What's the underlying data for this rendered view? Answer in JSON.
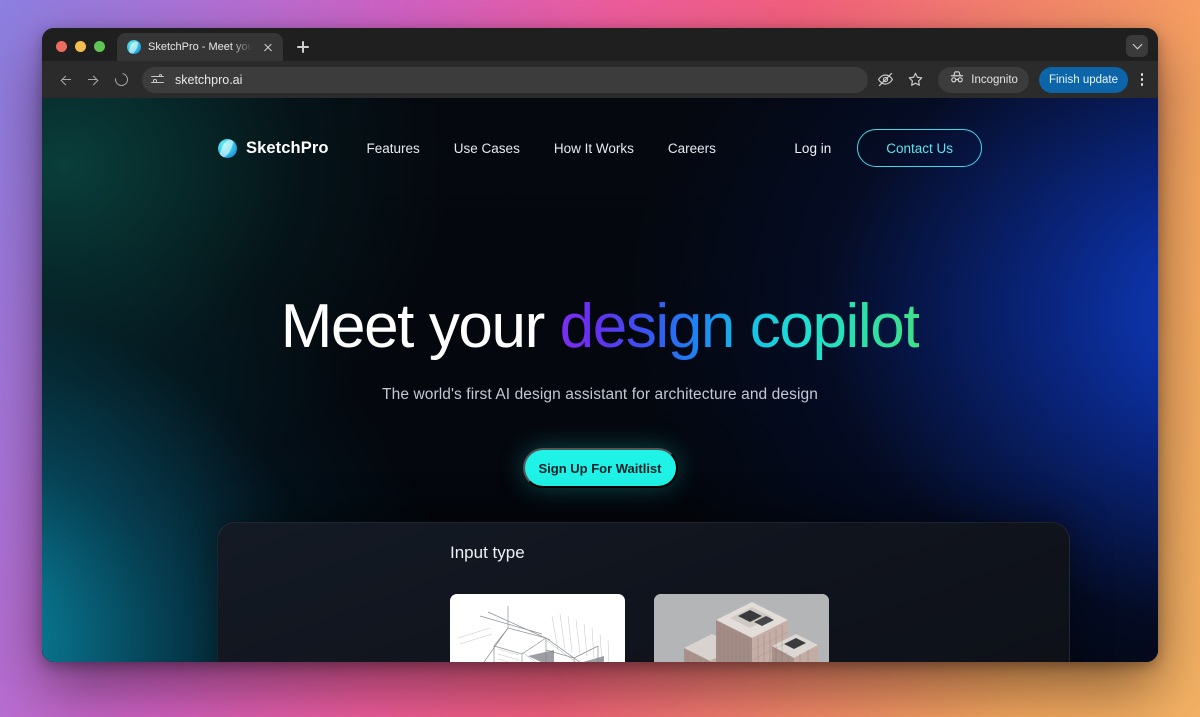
{
  "browser": {
    "tab": {
      "title": "SketchPro - Meet your design",
      "favicon_icon": "sketchpro-logo-icon",
      "close_icon": "close-icon"
    },
    "new_tab_icon": "plus-icon",
    "tab_list_icon": "chevron-down-icon",
    "nav": {
      "back_icon": "back-arrow-icon",
      "forward_icon": "forward-arrow-icon",
      "reload_icon": "reload-icon"
    },
    "omnibox": {
      "site_settings_icon": "tune-sliders-icon",
      "url": "sketchpro.ai"
    },
    "actions": {
      "tracking_protection_icon": "eye-slash-icon",
      "bookmark_icon": "star-icon",
      "incognito_icon": "incognito-hat-icon",
      "incognito_label": "Incognito",
      "update_label": "Finish update",
      "menu_icon": "kebab-menu-icon"
    },
    "window_controls": {
      "close": "close-traffic-light",
      "minimize": "minimize-traffic-light",
      "maximize": "maximize-traffic-light"
    }
  },
  "site": {
    "brand": {
      "name": "SketchPro",
      "logo_icon": "sketchpro-logo-icon"
    },
    "nav_links": [
      {
        "label": "Features"
      },
      {
        "label": "Use Cases"
      },
      {
        "label": "How It Works"
      },
      {
        "label": "Careers"
      }
    ],
    "login_label": "Log in",
    "contact_label": "Contact Us",
    "hero": {
      "headline_plain": "Meet your ",
      "headline_gradient": "design copilot",
      "subtitle": "The world's first AI design assistant for architecture and design",
      "cta_label": "Sign Up For Waitlist"
    },
    "panel": {
      "title": "Input type",
      "options": [
        {
          "name": "sketch-thumbnail",
          "alt": "architectural line sketch"
        },
        {
          "name": "render-thumbnail",
          "alt": "isometric 3d building render"
        }
      ]
    }
  },
  "colors": {
    "accent_cyan": "#1ff2e6",
    "contact_border": "#3fd8e8",
    "update_blue": "#0b65a8",
    "gradient_start": "#7c2ff0",
    "gradient_end": "#3fe08a"
  }
}
